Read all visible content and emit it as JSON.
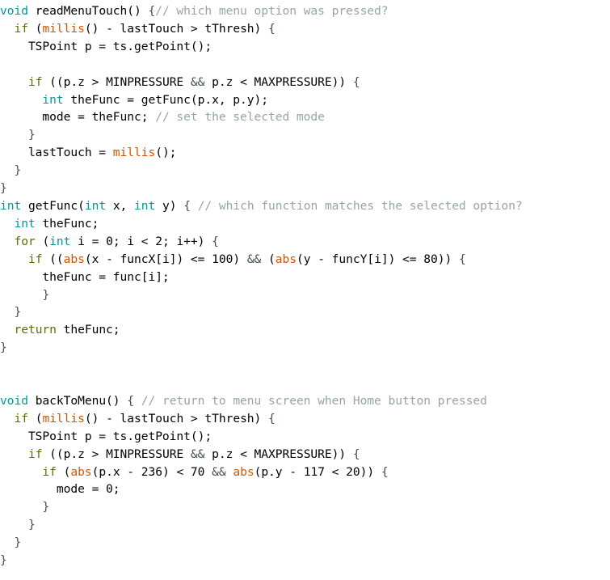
{
  "colors": {
    "background": "#ffffff",
    "plain": "#000000",
    "keyword": "#5e6d03",
    "type": "#00979c",
    "function": "#d35400",
    "comment": "#95a5a6",
    "operator": "#728e00",
    "punctuation": "#434f54"
  },
  "editor": {
    "language": "C++ (Arduino)",
    "font": "monospace",
    "total_lines": 33
  },
  "code": {
    "plain_text": "void readMenuTouch() {// which menu option was pressed?\n  if (millis() - lastTouch > tThresh) {\n    TSPoint p = ts.getPoint();\n\n    if ((p.z > MINPRESSURE && p.z < MAXPRESSURE)) {\n      int theFunc = getFunc(p.x, p.y);\n      mode = theFunc; // set the selected mode\n    }\n    lastTouch = millis();\n  }\n}\nint getFunc(int x, int y) { // which function matches the selected option?\n  int theFunc;\n  for (int i = 0; i < 2; i++) {\n    if ((abs(x - funcX[i]) <= 100) && (abs(y - funcY[i]) <= 80)) {\n      theFunc = func[i];\n    }\n  }\n  return theFunc;\n}\n\n\nvoid backToMenu() { // return to menu screen when Home button pressed\n  if (millis() - lastTouch > tThresh) {\n    TSPoint p = ts.getPoint();\n    if ((p.z > MINPRESSURE && p.z < MAXPRESSURE)) {\n      if (abs(p.x - 236) < 70 && abs(p.y - 117 < 20)) {\n        mode = 0;\n      }\n    }\n  }\n}",
    "lines": [
      [
        {
          "t": "void",
          "c": "type"
        },
        {
          "t": " readMenuTouch() ",
          "c": "plain"
        },
        {
          "t": "{",
          "c": "punct"
        },
        {
          "t": "// which menu option was pressed?",
          "c": "comment"
        }
      ],
      [
        {
          "t": "  ",
          "c": "plain"
        },
        {
          "t": "if",
          "c": "keyword"
        },
        {
          "t": " (",
          "c": "plain"
        },
        {
          "t": "millis",
          "c": "func"
        },
        {
          "t": "() - lastTouch > tThresh) ",
          "c": "plain"
        },
        {
          "t": "{",
          "c": "punct"
        }
      ],
      [
        {
          "t": "    TSPoint p = ts.getPoint();",
          "c": "plain"
        }
      ],
      [],
      [
        {
          "t": "    ",
          "c": "plain"
        },
        {
          "t": "if",
          "c": "keyword"
        },
        {
          "t": " ((p.z > MINPRESSURE ",
          "c": "plain"
        },
        {
          "t": "&&",
          "c": "punct"
        },
        {
          "t": " p.z < MAXPRESSURE)) ",
          "c": "plain"
        },
        {
          "t": "{",
          "c": "punct"
        }
      ],
      [
        {
          "t": "      ",
          "c": "plain"
        },
        {
          "t": "int",
          "c": "type"
        },
        {
          "t": " theFunc = getFunc(p.x, p.y);",
          "c": "plain"
        }
      ],
      [
        {
          "t": "      mode = theFunc; ",
          "c": "plain"
        },
        {
          "t": "// set the selected mode",
          "c": "comment"
        }
      ],
      [
        {
          "t": "    ",
          "c": "plain"
        },
        {
          "t": "}",
          "c": "punct"
        }
      ],
      [
        {
          "t": "    lastTouch = ",
          "c": "plain"
        },
        {
          "t": "millis",
          "c": "func"
        },
        {
          "t": "();",
          "c": "plain"
        }
      ],
      [
        {
          "t": "  ",
          "c": "plain"
        },
        {
          "t": "}",
          "c": "punct"
        }
      ],
      [
        {
          "t": "}",
          "c": "punct"
        }
      ],
      [
        {
          "t": "int",
          "c": "type"
        },
        {
          "t": " getFunc(",
          "c": "plain"
        },
        {
          "t": "int",
          "c": "type"
        },
        {
          "t": " x, ",
          "c": "plain"
        },
        {
          "t": "int",
          "c": "type"
        },
        {
          "t": " y) ",
          "c": "plain"
        },
        {
          "t": "{",
          "c": "punct"
        },
        {
          "t": " // which function matches the selected option?",
          "c": "comment"
        }
      ],
      [
        {
          "t": "  ",
          "c": "plain"
        },
        {
          "t": "int",
          "c": "type"
        },
        {
          "t": " theFunc;",
          "c": "plain"
        }
      ],
      [
        {
          "t": "  ",
          "c": "plain"
        },
        {
          "t": "for",
          "c": "keyword"
        },
        {
          "t": " (",
          "c": "plain"
        },
        {
          "t": "int",
          "c": "type"
        },
        {
          "t": " i = 0; i < 2; i++) ",
          "c": "plain"
        },
        {
          "t": "{",
          "c": "punct"
        }
      ],
      [
        {
          "t": "    ",
          "c": "plain"
        },
        {
          "t": "if",
          "c": "keyword"
        },
        {
          "t": " ((",
          "c": "plain"
        },
        {
          "t": "abs",
          "c": "func"
        },
        {
          "t": "(x - funcX[i]) <= 100) ",
          "c": "plain"
        },
        {
          "t": "&&",
          "c": "punct"
        },
        {
          "t": " (",
          "c": "plain"
        },
        {
          "t": "abs",
          "c": "func"
        },
        {
          "t": "(y - funcY[i]) <= 80)) ",
          "c": "plain"
        },
        {
          "t": "{",
          "c": "punct"
        }
      ],
      [
        {
          "t": "      theFunc = func[i];",
          "c": "plain"
        }
      ],
      [
        {
          "t": "      ",
          "c": "plain"
        },
        {
          "t": "}",
          "c": "punct"
        }
      ],
      [
        {
          "t": "  ",
          "c": "plain"
        },
        {
          "t": "}",
          "c": "punct"
        }
      ],
      [
        {
          "t": "  ",
          "c": "plain"
        },
        {
          "t": "return",
          "c": "keyword"
        },
        {
          "t": " theFunc;",
          "c": "plain"
        }
      ],
      [
        {
          "t": "}",
          "c": "punct"
        }
      ],
      [],
      [],
      [
        {
          "t": "void",
          "c": "type"
        },
        {
          "t": " backToMenu() ",
          "c": "plain"
        },
        {
          "t": "{",
          "c": "punct"
        },
        {
          "t": " // return to menu screen when Home button pressed",
          "c": "comment"
        }
      ],
      [
        {
          "t": "  ",
          "c": "plain"
        },
        {
          "t": "if",
          "c": "keyword"
        },
        {
          "t": " (",
          "c": "plain"
        },
        {
          "t": "millis",
          "c": "func"
        },
        {
          "t": "() - lastTouch > tThresh) ",
          "c": "plain"
        },
        {
          "t": "{",
          "c": "punct"
        }
      ],
      [
        {
          "t": "    TSPoint p = ts.getPoint();",
          "c": "plain"
        }
      ],
      [
        {
          "t": "    ",
          "c": "plain"
        },
        {
          "t": "if",
          "c": "keyword"
        },
        {
          "t": " ((p.z > MINPRESSURE ",
          "c": "plain"
        },
        {
          "t": "&&",
          "c": "punct"
        },
        {
          "t": " p.z < MAXPRESSURE)) ",
          "c": "plain"
        },
        {
          "t": "{",
          "c": "punct"
        }
      ],
      [
        {
          "t": "      ",
          "c": "plain"
        },
        {
          "t": "if",
          "c": "keyword"
        },
        {
          "t": " (",
          "c": "plain"
        },
        {
          "t": "abs",
          "c": "func"
        },
        {
          "t": "(p.x - 236) < 70 ",
          "c": "plain"
        },
        {
          "t": "&&",
          "c": "punct"
        },
        {
          "t": " ",
          "c": "plain"
        },
        {
          "t": "abs",
          "c": "func"
        },
        {
          "t": "(p.y - 117 < 20)) ",
          "c": "plain"
        },
        {
          "t": "{",
          "c": "punct"
        }
      ],
      [
        {
          "t": "        mode = 0;",
          "c": "plain"
        }
      ],
      [
        {
          "t": "      ",
          "c": "plain"
        },
        {
          "t": "}",
          "c": "punct"
        }
      ],
      [
        {
          "t": "    ",
          "c": "plain"
        },
        {
          "t": "}",
          "c": "punct"
        }
      ],
      [
        {
          "t": "  ",
          "c": "plain"
        },
        {
          "t": "}",
          "c": "punct"
        }
      ],
      [
        {
          "t": "}",
          "c": "punct"
        }
      ]
    ]
  }
}
